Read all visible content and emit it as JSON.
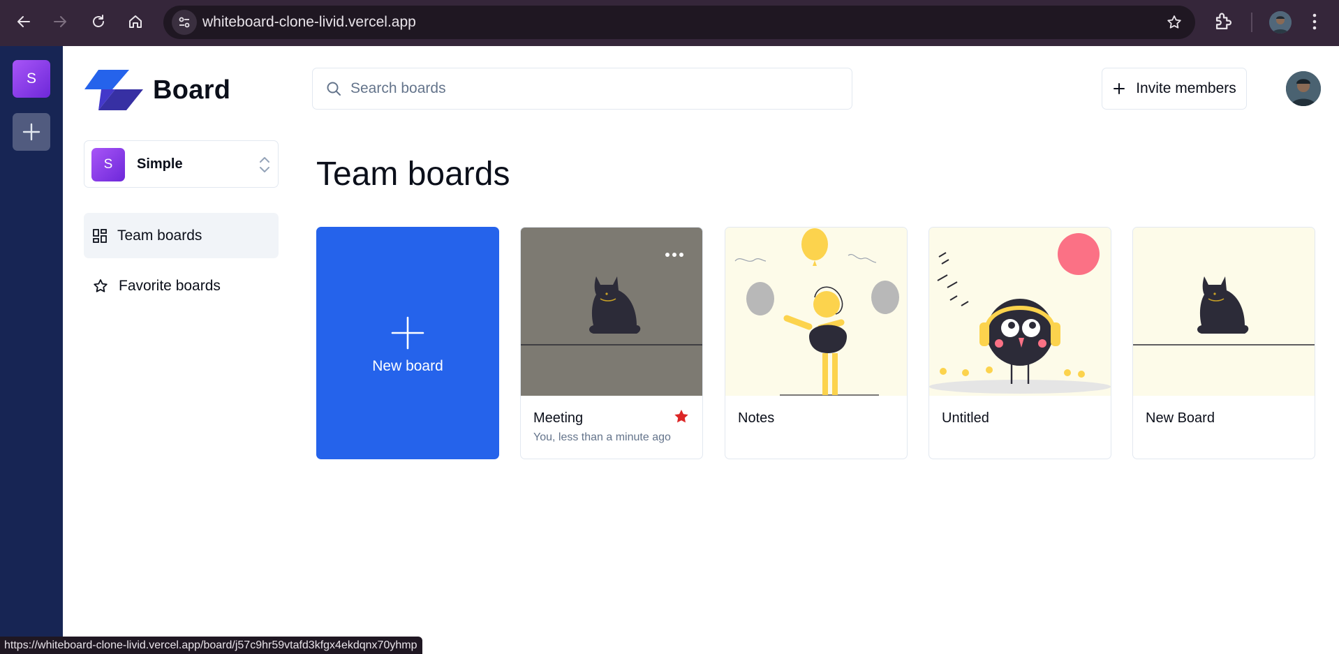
{
  "browser": {
    "url": "whiteboard-clone-livid.vercel.app",
    "status_url": "https://whiteboard-clone-livid.vercel.app/board/j57c9hr59vtafd3kfgx4ekdqnx70yhmp"
  },
  "rail": {
    "org_initial": "S"
  },
  "sidebar": {
    "logo_text": "Board",
    "org": {
      "initial": "S",
      "name": "Simple"
    },
    "items": [
      {
        "label": "Team boards",
        "icon": "dashboard-icon",
        "active": true
      },
      {
        "label": "Favorite boards",
        "icon": "star-icon",
        "active": false
      }
    ]
  },
  "header": {
    "search_placeholder": "Search boards",
    "invite_label": "Invite members"
  },
  "main": {
    "title": "Team boards",
    "new_board_label": "New board",
    "boards": [
      {
        "title": "Meeting",
        "subtitle": "You, less than a minute ago",
        "favorite": true,
        "thumb": "cat-gray"
      },
      {
        "title": "Notes",
        "subtitle": "",
        "favorite": false,
        "thumb": "balloons"
      },
      {
        "title": "Untitled",
        "subtitle": "",
        "favorite": false,
        "thumb": "bird"
      },
      {
        "title": "New Board",
        "subtitle": "",
        "favorite": false,
        "thumb": "cat-cream"
      }
    ]
  },
  "colors": {
    "primary": "#2563eb",
    "rail": "#172554",
    "favorite": "#dc2626"
  }
}
